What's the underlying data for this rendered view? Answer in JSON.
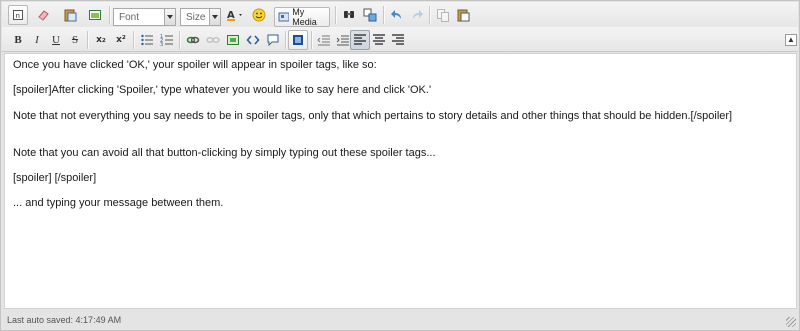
{
  "toolbar": {
    "font_select": "Font",
    "size_select": "Size",
    "my_media_label": "My Media",
    "format_labels": {
      "bold": "B",
      "italic": "I",
      "underline": "U",
      "strike": "S",
      "subscript": "x₂",
      "superscript": "x²"
    },
    "icons": [
      "source-icon",
      "remove-format-icon",
      "paste-plain-icon",
      "maximize-icon",
      "text-color-icon",
      "smiley-icon",
      "find-icon",
      "replace-icon",
      "undo-icon",
      "redo-icon",
      "copy-icon",
      "paste-icon",
      "bullet-list-icon",
      "numbered-list-icon",
      "link-icon",
      "unlink-icon",
      "image-icon",
      "code-icon",
      "quote-icon",
      "spoiler-icon",
      "outdent-icon",
      "indent-icon",
      "align-left-icon",
      "align-center-icon",
      "align-right-icon"
    ],
    "active_alignment": "align-left"
  },
  "content": {
    "lines": [
      "Once you have clicked 'OK,' your spoiler will appear in spoiler tags, like so:",
      "[spoiler]After clicking 'Spoiler,' type whatever you would like to say here and click 'OK.'",
      "Note that not everything you say needs to be in spoiler tags, only that which pertains to story details and other things that should be hidden.[/spoiler]",
      "Note that you can avoid all that button-clicking by simply typing out these spoiler tags...",
      "[spoiler] [/spoiler]",
      "... and typing your message between them."
    ]
  },
  "status": {
    "autosave": "Last auto saved: 4:17:49 AM"
  },
  "colors": {
    "toolbar_bg": "#ececec",
    "editor_bg": "#ffffff",
    "frame_bg": "#e4e4e4"
  }
}
